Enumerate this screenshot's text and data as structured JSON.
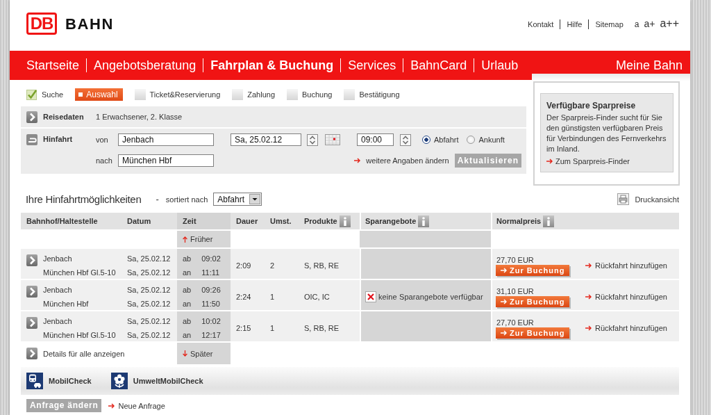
{
  "header": {
    "logo": "DB",
    "brand": "BAHN",
    "service_links": [
      "Kontakt",
      "Hilfe",
      "Sitemap"
    ],
    "text_sizes": [
      "a",
      "a+",
      "a++"
    ]
  },
  "nav": {
    "items": [
      {
        "label": "Startseite",
        "selected": false
      },
      {
        "label": "Angebotsberatung",
        "selected": false
      },
      {
        "label": "Fahrplan & Buchung",
        "selected": true
      },
      {
        "label": "Services",
        "selected": false
      },
      {
        "label": "BahnCard",
        "selected": false
      },
      {
        "label": "Urlaub",
        "selected": false
      }
    ],
    "account_link": "Meine Bahn"
  },
  "progress": {
    "steps": [
      {
        "label": "Suche",
        "completed": true,
        "selected": false
      },
      {
        "label": "Auswahl",
        "completed": false,
        "selected": true
      },
      {
        "label": "Ticket&Reservierung",
        "completed": false,
        "selected": false
      },
      {
        "label": "Zahlung",
        "completed": false,
        "selected": false
      },
      {
        "label": "Buchung",
        "completed": false,
        "selected": false
      },
      {
        "label": "Bestätigung",
        "completed": false,
        "selected": false
      }
    ]
  },
  "travel_data": {
    "title": "Reisedaten",
    "summary": "1 Erwachsener, 2. Klasse"
  },
  "outbound": {
    "title": "Hinfahrt",
    "from_label": "von",
    "from": "Jenbach",
    "to_label": "nach",
    "to": "München Hbf",
    "date": "Sa, 25.02.12",
    "time": "09:00",
    "time_modes": [
      {
        "label": "Abfahrt",
        "selected": true
      },
      {
        "label": "Ankunft",
        "selected": false
      }
    ],
    "more_link": "weitere Angaben ändern",
    "update_button": "Aktualisieren"
  },
  "sidebar": {
    "title": "Verfügbare Sparpreise",
    "text": "Der Sparpreis-Finder sucht für Sie den günstigsten verfügbaren Preis für Verbindungen des Fernverkehrs im Inland.",
    "link": "Zum Sparpreis-Finder"
  },
  "results": {
    "title": "Ihre Hinfahrtmöglichkeiten",
    "separator": "-",
    "sort_label": "sortiert nach",
    "sort_value": "Abfahrt",
    "print_link": "Druckansicht",
    "columns": [
      {
        "label": "Bahnhof/Haltestelle",
        "info": false
      },
      {
        "label": "Datum",
        "info": false
      },
      {
        "label": "Zeit",
        "info": false
      },
      {
        "label": "Dauer",
        "info": false
      },
      {
        "label": "Umst.",
        "info": false
      },
      {
        "label": "Produkte",
        "info": true
      },
      {
        "label": "Sparangebote",
        "info": true
      },
      {
        "label": "Normalpreis",
        "info": true
      }
    ],
    "earlier_link": "Früher",
    "rows": [
      {
        "stops": [
          {
            "station": "Jenbach",
            "date": "Sa, 25.02.12",
            "time_label": "ab",
            "time": "09:02"
          },
          {
            "station": "München Hbf Gl.5-10",
            "date": "Sa, 25.02.12",
            "time_label": "an",
            "time": "11:11"
          }
        ],
        "duration": "2:09",
        "changes": "2",
        "products": "S, RB, RE",
        "price": "27,70 EUR",
        "book_button": "Zur Buchung",
        "return_link": "Rückfahrt hinzufügen"
      },
      {
        "stops": [
          {
            "station": "Jenbach",
            "date": "Sa, 25.02.12",
            "time_label": "ab",
            "time": "09:26"
          },
          {
            "station": "München Hbf",
            "date": "Sa, 25.02.12",
            "time_label": "an",
            "time": "11:50"
          }
        ],
        "duration": "2:24",
        "changes": "1",
        "products": "OIC, IC",
        "saver_offer": "keine Sparangebote verfügbar",
        "price": "31,10 EUR",
        "book_button": "Zur Buchung",
        "return_link": "Rückfahrt hinzufügen"
      },
      {
        "stops": [
          {
            "station": "Jenbach",
            "date": "Sa, 25.02.12",
            "time_label": "ab",
            "time": "10:02"
          },
          {
            "station": "München Hbf Gl.5-10",
            "date": "Sa, 25.02.12",
            "time_label": "an",
            "time": "12:17"
          }
        ],
        "duration": "2:15",
        "changes": "1",
        "products": "S, RB, RE",
        "price": "27,70 EUR",
        "book_button": "Zur Buchung",
        "return_link": "Rückfahrt hinzufügen"
      }
    ],
    "details_link": "Details für alle anzeigen",
    "later_link": "Später"
  },
  "tools": [
    {
      "label": "MobilCheck",
      "kind": "mobility"
    },
    {
      "label": "UmweltMobilCheck",
      "kind": "environment"
    }
  ],
  "footer": {
    "change_button": "Anfrage ändern",
    "new_query_link": "Neue Anfrage"
  }
}
